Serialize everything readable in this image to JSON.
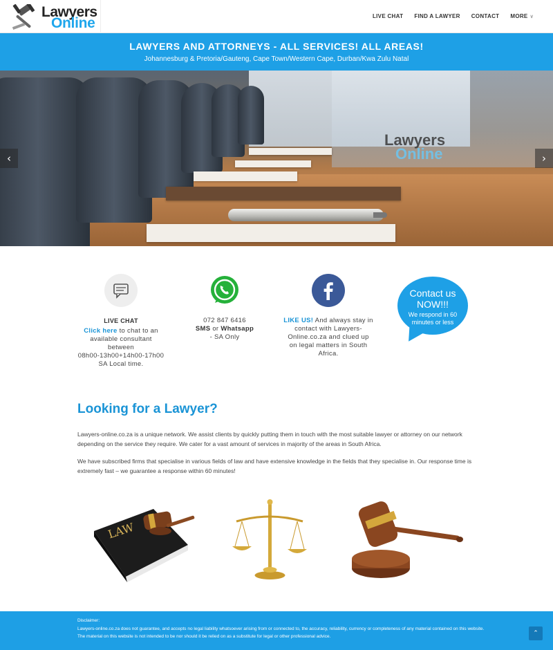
{
  "header": {
    "logo_line1": "Lawyers",
    "logo_line2": "Online",
    "nav": [
      {
        "label": "LIVE CHAT"
      },
      {
        "label": "FIND A LAWYER"
      },
      {
        "label": "CONTACT"
      },
      {
        "label": "MORE"
      }
    ]
  },
  "banner": {
    "title": "LAWYERS AND ATTORNEYS - ALL SERVICES! ALL AREAS!",
    "subtitle": "Johannesburg & Pretoria/Gauteng, Cape Town/Western Cape, Durban/Kwa Zulu Natal"
  },
  "hero": {
    "logo_line1": "Lawyers",
    "logo_line2": "Online",
    "prev_arrow": "‹",
    "next_arrow": "›"
  },
  "features": {
    "live_chat": {
      "title": "LIVE CHAT",
      "link": "Click here",
      "text1": " to chat to an available consultant between",
      "hours": "08h00-13h00+14h00-17h00",
      "text2": "SA Local time."
    },
    "whatsapp": {
      "phone": "072 847 6416",
      "sms": "SMS",
      "or": " or ",
      "whatsapp": "Whatsapp",
      "note": "- SA Only"
    },
    "facebook": {
      "like": "LIKE US!",
      "text": " And always stay in contact with Lawyers-Online.co.za and clued up on legal matters in South Africa."
    },
    "contact_bubble": {
      "main": "Contact us NOW!!!",
      "sub": "We respond in 60 minutes or less"
    }
  },
  "about": {
    "title": "Looking for a Lawyer?",
    "paragraph1": "Lawyers-online.co.za is a unique network. We assist clients by quickly putting them in touch with the most suitable lawyer or attorney on our network depending on the service they require. We cater for a vast amount of services in majority of the areas in South Africa.",
    "paragraph2": "We have subscribed firms that specialise in various fields of law and have extensive knowledge in the fields that they specialise in. Our response time is extremely fast – we guarantee a response within 60 minutes!"
  },
  "images": {
    "book_label": "LAW"
  },
  "footer": {
    "label": "Disclaimer:",
    "text": "Lawyers-online.co.za does not guarantee, and accepts no legal liability whatsoever arising from or connected to, the accuracy, reliability, currency or completeness of any material contained on this website. The material on this website is not intended to be nor should it be relied on as a substitute for legal or other professional advice.",
    "back_to_top": "⌃"
  },
  "colors": {
    "brand_blue": "#1ea0e6",
    "link_blue": "#1a94d6",
    "whatsapp_green": "#25b13a",
    "facebook_blue": "#3b5998"
  }
}
